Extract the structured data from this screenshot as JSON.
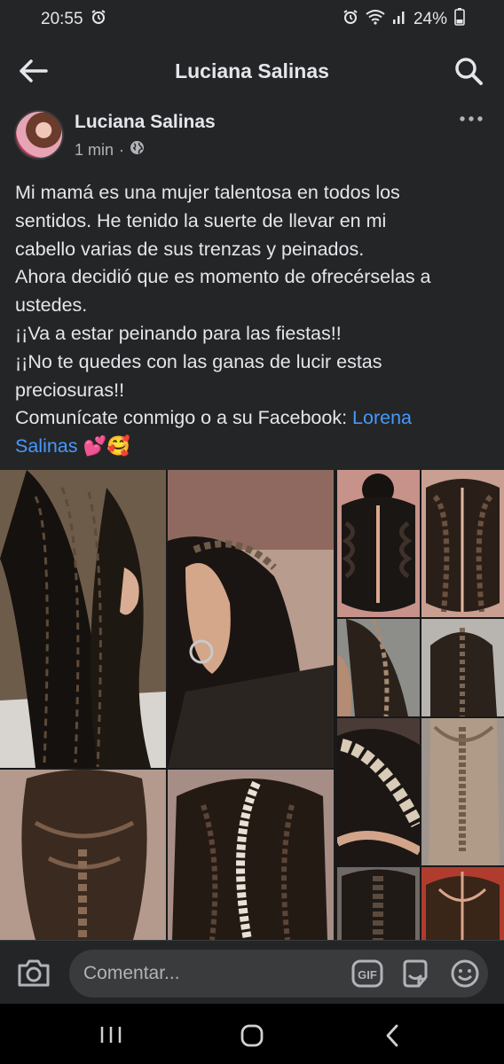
{
  "status_bar": {
    "time": "20:55",
    "battery": "24%",
    "icons": [
      "alarm-icon",
      "alarm-icon",
      "wifi-icon",
      "signal-icon",
      "battery-icon"
    ]
  },
  "header": {
    "title": "Luciana Salinas",
    "back_icon": "arrow-left-icon",
    "search_icon": "search-icon"
  },
  "post": {
    "author": "Luciana Salinas",
    "time": "1 min",
    "separator": "·",
    "privacy_icon": "globe-icon",
    "more_icon": "more-horizontal-icon",
    "lines": [
      "Mi mamá es una mujer talentosa en todos los",
      "sentidos. He tenido la suerte de llevar en mi",
      "cabello varias de sus trenzas y peinados.",
      "Ahora decidió que es momento de ofrecérselas a",
      "ustedes.",
      "¡¡Va a estar peinando para las fiestas!!",
      "¡¡No te quedes con las ganas de lucir estas",
      "preciosuras!!",
      "Comunícate conmigo o a su Facebook: "
    ],
    "link_line1": "Lorena",
    "link_line2": "Salinas",
    "emojis": "💕🥰",
    "photos": [
      "braids-photo-1",
      "braids-photo-2",
      "braids-photo-3",
      "braids-photo-4",
      "braids-photo-5",
      "braids-photo-6",
      "braids-photo-7",
      "braids-photo-8",
      "braids-photo-9",
      "braids-photo-10",
      "braids-photo-11",
      "braids-photo-12"
    ]
  },
  "comment_bar": {
    "placeholder": "Comentar...",
    "gif_label": "GIF"
  },
  "colors": {
    "background": "#18191a",
    "surface": "#242526",
    "input": "#3a3b3c",
    "text_primary": "#e4e6eb",
    "text_secondary": "#b0b3b8",
    "link": "#4599ff"
  }
}
